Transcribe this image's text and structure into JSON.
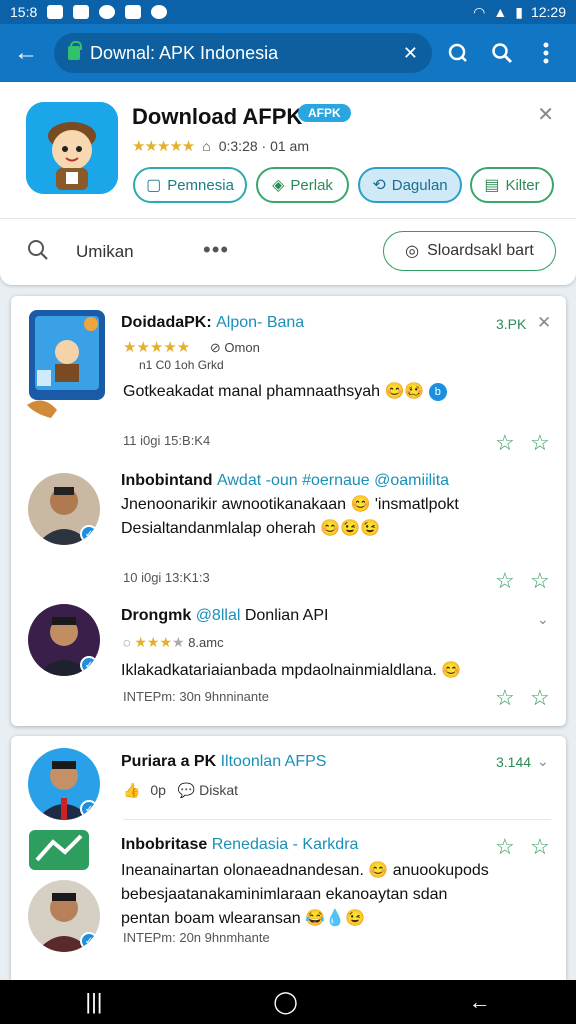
{
  "status": {
    "time": "12:29",
    "left_time": "15:8"
  },
  "toolbar": {
    "url": "Downal: APK Indonesia"
  },
  "app": {
    "title": "Download AFPK",
    "badge": "AFPK",
    "rating_text": "0:3:28 · 01 am",
    "buttons": [
      "Pemnesia",
      "Perlak",
      "Dagulan",
      "Kilter"
    ],
    "search_label": "Umikan",
    "download_button": "Sloardsakl bart"
  },
  "feed": [
    {
      "title": "DoidadaPK:",
      "title_accent": "Alpon- Bana",
      "value": "3.PK",
      "meta": "Omon",
      "meta2": "n1 C0 1oh Grkd",
      "body": [
        "Gotkeakadat manal phamnaathsyah 😊🥴"
      ],
      "time": "11 i0gi 15:B:K4"
    },
    {
      "title": "Inbobintand",
      "title_accent": "Awdat -oun #oernaue @oamiilita",
      "body": [
        "Jnenoonarikir awnootikanakaan 😊 'insmatlpokt",
        "Desialtandanmlalap oherah 😊😉😉"
      ],
      "time": "10 i0gi 13:K1:3"
    },
    {
      "title": "Drongmk",
      "title_accent": "@8llal",
      "title_tail": "Donlian API",
      "meta": "8.amc",
      "body": [
        "Iklakadkatariaianbada mpdaolnainmialdlana. 😊"
      ],
      "time": "INTEPm: 30n 9hnninante"
    },
    {
      "title": "Puriara a PK",
      "title_accent": "Iltoonlan AFPS",
      "value": "3.144",
      "meta": "0p",
      "meta2": "Diskat"
    },
    {
      "title": "Inbobritase",
      "title_accent": "Renedasia - Karkdra",
      "body": [
        "Ineanainartan olonaeadnandesan. 😊 anuookupods",
        "bebesjaatanakaminimlaraan ekanoaytan sdan",
        "pentan boam wlearansan 😂💧😉"
      ],
      "time": "INTEPm: 20n 9hnmhante"
    }
  ],
  "colors": {
    "appbar": "#1177c4",
    "statusbar": "#0b62a8",
    "accent_green": "#2e9e5e",
    "accent_teal": "#2eaab2"
  }
}
